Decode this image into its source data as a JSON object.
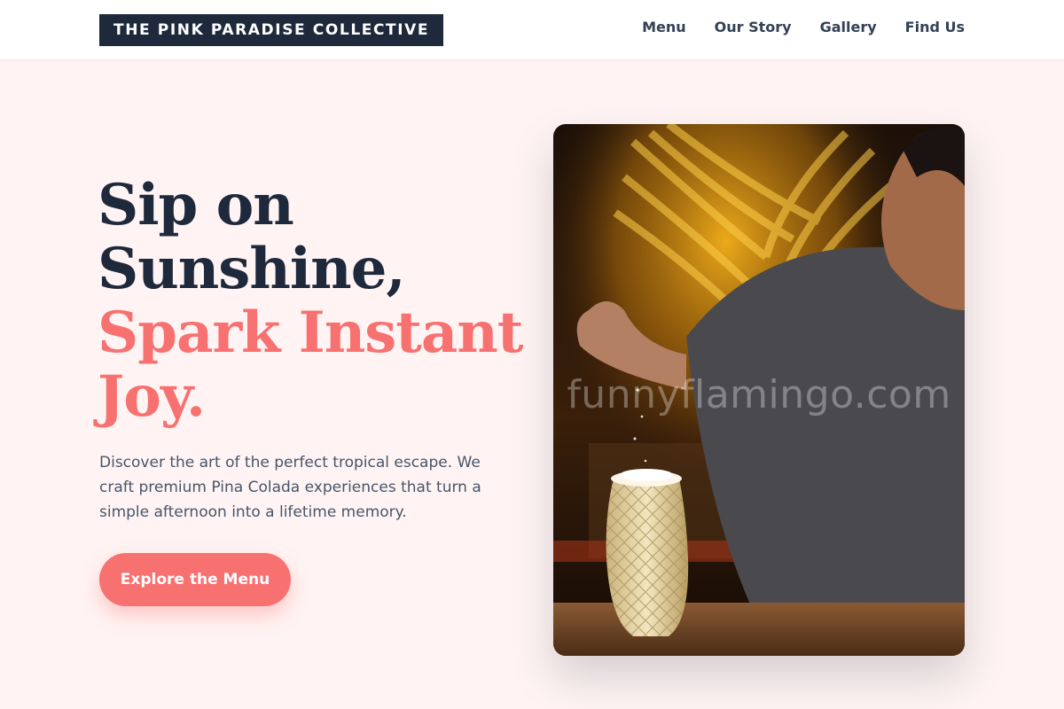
{
  "brand": {
    "name": "THE PINK PARADISE COLLECTIVE"
  },
  "nav": {
    "items": [
      {
        "label": "Menu"
      },
      {
        "label": "Our Story"
      },
      {
        "label": "Gallery"
      },
      {
        "label": "Find Us"
      }
    ]
  },
  "hero": {
    "title_line1": "Sip on",
    "title_line2": "Sunshine,",
    "title_line3": "Spark Instant",
    "title_line4": "Joy.",
    "description": "Discover the art of the perfect tropical escape. We craft premium Pina Colada experiences that turn a simple afternoon into a lifetime memory.",
    "cta_label": "Explore the Menu",
    "image_watermark": "funnyflamingo.com"
  },
  "colors": {
    "page_background": "#fff4f3",
    "navy": "#1e293b",
    "coral": "#f87171",
    "body_text": "#475569"
  }
}
